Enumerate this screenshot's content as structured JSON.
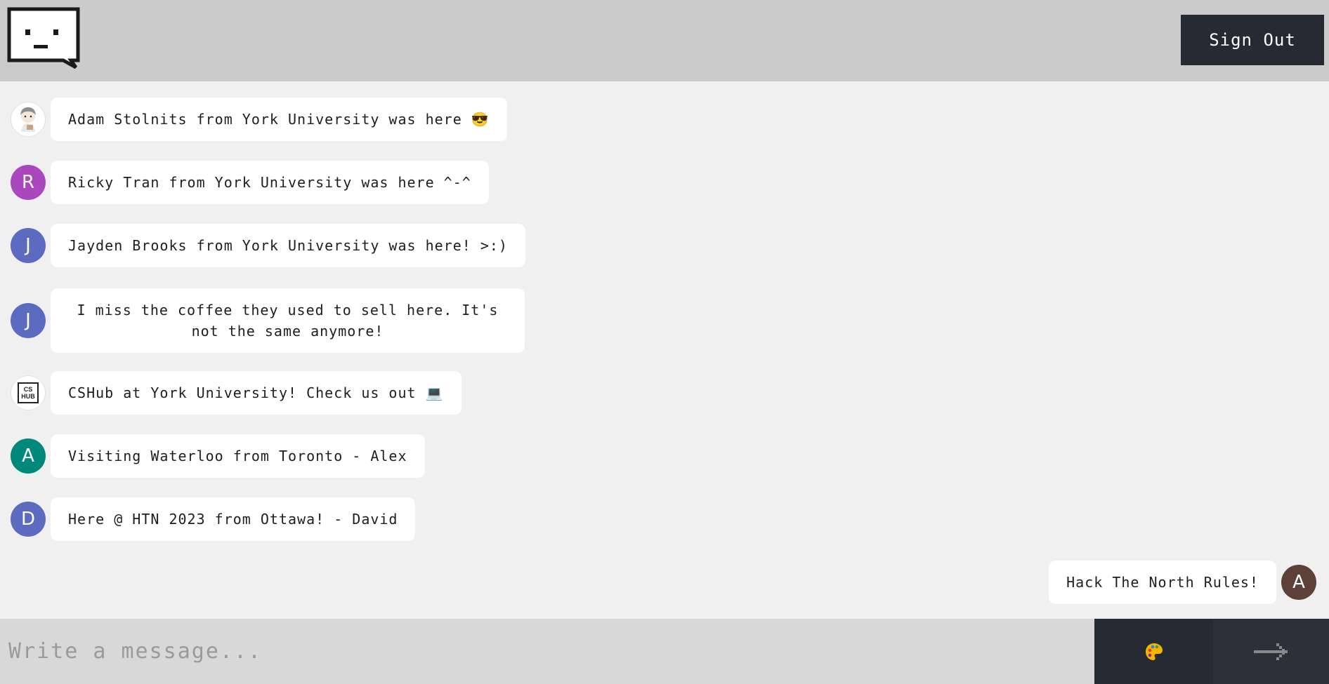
{
  "header": {
    "logo_icon": "speech-bubble-face-icon",
    "signout_label": "Sign Out"
  },
  "messages": [
    {
      "text": "Adam Stolnits from York University was here 😎",
      "avatar_letter": "",
      "avatar_type": "illustration",
      "side": "left"
    },
    {
      "text": "Ricky Tran from York University was here ^-^",
      "avatar_letter": "R",
      "avatar_color": "#ab47bc",
      "side": "left"
    },
    {
      "text": "Jayden Brooks from York University was here! >:)",
      "avatar_letter": "J",
      "avatar_color": "#5c6bc0",
      "side": "left"
    },
    {
      "text": "I miss the coffee they used to sell here. It's not the same anymore!",
      "avatar_letter": "J",
      "avatar_color": "#5c6bc0",
      "side": "left"
    },
    {
      "text": "CSHub at York University! Check us out 💻",
      "avatar_letter": "",
      "avatar_type": "cshub-logo",
      "avatar_logo_text": "CS HUB",
      "side": "left"
    },
    {
      "text": "Visiting Waterloo from Toronto - Alex",
      "avatar_letter": "A",
      "avatar_color": "#00897b",
      "side": "left"
    },
    {
      "text": "Here @ HTN 2023 from Ottawa! - David",
      "avatar_letter": "D",
      "avatar_color": "#5c6bc0",
      "side": "left"
    },
    {
      "text": "Hack The North Rules!",
      "avatar_letter": "A",
      "avatar_color": "#5d4037",
      "side": "right"
    }
  ],
  "footer": {
    "input_placeholder": "Write a message...",
    "input_value": "",
    "palette_icon": "palette-icon",
    "send_icon": "arrow-right-icon"
  },
  "colors": {
    "header_bg": "#cbcbcb",
    "chat_bg": "#f0f0f0",
    "button_dark": "#252a33"
  }
}
